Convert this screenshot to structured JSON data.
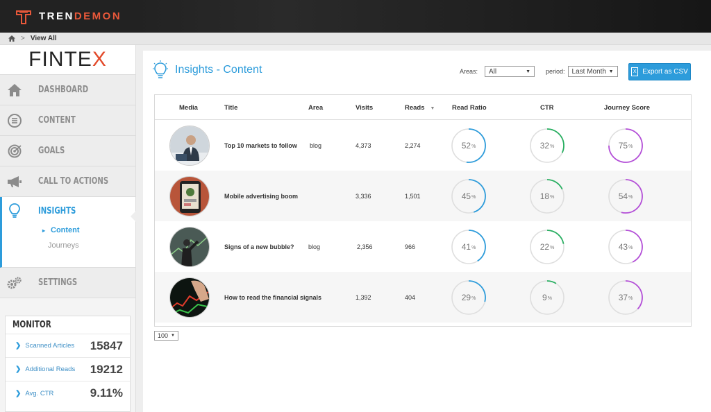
{
  "app": {
    "logo_tren": "TREN",
    "logo_demon": "DEMON"
  },
  "breadcrumb": {
    "home_icon": "home-icon",
    "separator": ">",
    "label": "View All"
  },
  "sidebar": {
    "brand_main": "FINTE",
    "brand_x": "X",
    "items": [
      {
        "label": "DASHBOARD",
        "icon": "home-icon"
      },
      {
        "label": "CONTENT",
        "icon": "list-icon"
      },
      {
        "label": "GOALS",
        "icon": "target-icon"
      },
      {
        "label": "CALL TO ACTIONS",
        "icon": "megaphone-icon"
      },
      {
        "label": "INSIGHTS",
        "icon": "lightbulb-icon"
      },
      {
        "label": "SETTINGS",
        "icon": "gears-icon"
      }
    ],
    "insights_sub": [
      {
        "label": "Content"
      },
      {
        "label": "Journeys"
      }
    ],
    "monitor": {
      "title": "MONITOR",
      "rows": [
        {
          "label": "Scanned Articles",
          "value": "15847"
        },
        {
          "label": "Additional Reads",
          "value": "19212"
        },
        {
          "label": "Avg. CTR",
          "value": "9.11%"
        }
      ]
    }
  },
  "main": {
    "title": "Insights - Content",
    "filters": {
      "areas_label": "Areas:",
      "areas_value": "All",
      "period_label": "period:",
      "period_value": "Last Month"
    },
    "export_label": "Export as CSV",
    "columns": [
      "Media",
      "Title",
      "Area",
      "Visits",
      "Reads",
      "Read Ratio",
      "CTR",
      "Journey Score"
    ],
    "rows": [
      {
        "title": "Top 10 markets to follow",
        "area": "blog",
        "visits": "4,373",
        "reads": "2,274",
        "read_ratio": 52,
        "ctr": 32,
        "journey": 75
      },
      {
        "title": "Mobile advertising boom",
        "area": "",
        "visits": "3,336",
        "reads": "1,501",
        "read_ratio": 45,
        "ctr": 18,
        "journey": 54
      },
      {
        "title": "Signs of a new bubble?",
        "area": "blog",
        "visits": "2,356",
        "reads": "966",
        "read_ratio": 41,
        "ctr": 22,
        "journey": 43
      },
      {
        "title": "How to read the financial signals",
        "area": "",
        "visits": "1,392",
        "reads": "404",
        "read_ratio": 29,
        "ctr": 9,
        "journey": 37
      }
    ],
    "pager_value": "100",
    "percent_sign": "%",
    "colors": {
      "read_ratio": "#2d9cdb",
      "ctr": "#27ae60",
      "journey": "#b44fd8",
      "accent": "#2d9cdb"
    }
  }
}
